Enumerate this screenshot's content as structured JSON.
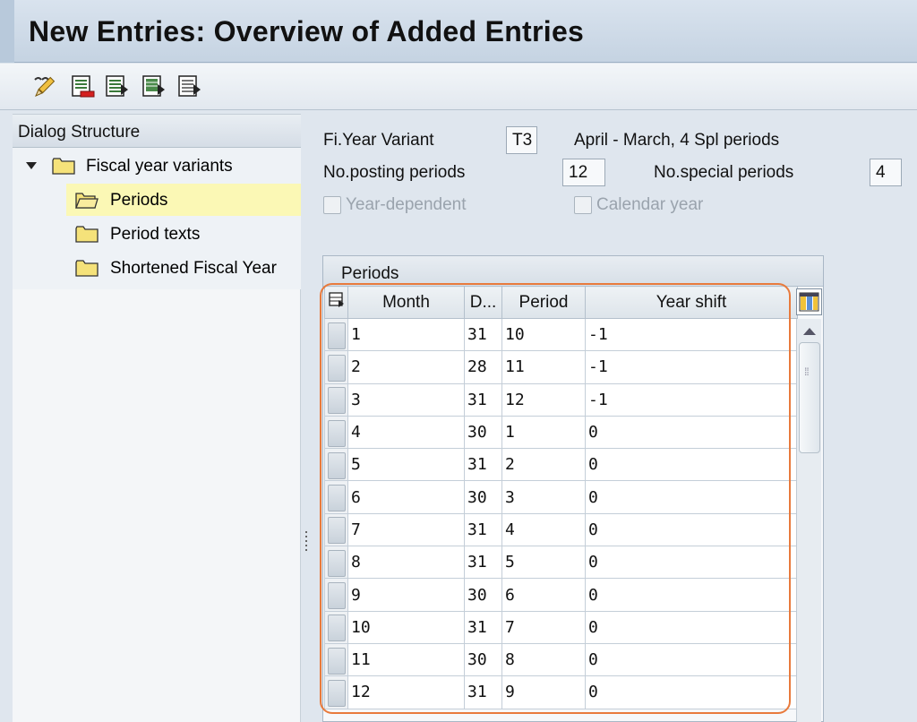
{
  "window": {
    "title": "New Entries: Overview of Added Entries"
  },
  "toolbar": {
    "buttons": [
      {
        "icon": "display-change-icon"
      },
      {
        "icon": "delete-entry-icon"
      },
      {
        "icon": "select-all-icon"
      },
      {
        "icon": "select-block-icon"
      },
      {
        "icon": "deselect-all-icon"
      }
    ]
  },
  "dialog_structure": {
    "title": "Dialog Structure",
    "items": [
      {
        "label": "Fiscal year variants",
        "icon": "folder-icon",
        "expanded": true
      },
      {
        "label": "Periods",
        "icon": "folder-open-icon",
        "selected": true
      },
      {
        "label": "Period texts",
        "icon": "folder-icon"
      },
      {
        "label": "Shortened Fiscal Year",
        "icon": "folder-icon"
      }
    ]
  },
  "header": {
    "fy_variant_label": "Fi.Year Variant",
    "fy_variant_value": "T3",
    "fy_variant_desc": "April - March, 4 Spl periods",
    "posting_periods_label": "No.posting periods",
    "posting_periods_value": "12",
    "special_periods_label": "No.special periods",
    "special_periods_value": "4",
    "year_dependent_label": "Year-dependent",
    "year_dependent_checked": false,
    "calendar_year_label": "Calendar year",
    "calendar_year_checked": false
  },
  "periods_table": {
    "title": "Periods",
    "columns": [
      "Month",
      "D...",
      "Period",
      "Year shift"
    ],
    "rows": [
      [
        "1",
        "31",
        "10",
        "-1"
      ],
      [
        "2",
        "28",
        "11",
        "-1"
      ],
      [
        "3",
        "31",
        "12",
        "-1"
      ],
      [
        "4",
        "30",
        "1",
        "0"
      ],
      [
        "5",
        "31",
        "2",
        "0"
      ],
      [
        "6",
        "30",
        "3",
        "0"
      ],
      [
        "7",
        "31",
        "4",
        "0"
      ],
      [
        "8",
        "31",
        "5",
        "0"
      ],
      [
        "9",
        "30",
        "6",
        "0"
      ],
      [
        "10",
        "31",
        "7",
        "0"
      ],
      [
        "11",
        "30",
        "8",
        "0"
      ],
      [
        "12",
        "31",
        "9",
        "0"
      ]
    ]
  },
  "colors": {
    "highlight": "#e87a3c",
    "selected_tree_item": "#fbf8b5",
    "folder": "#f5e27a"
  }
}
